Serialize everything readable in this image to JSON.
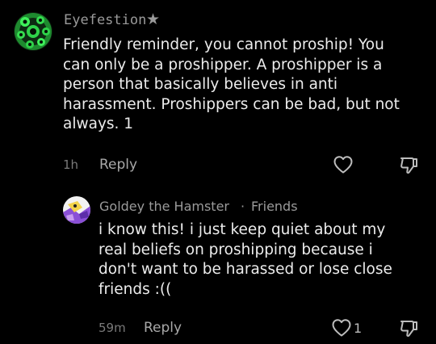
{
  "comment": {
    "username": "Eyefestion",
    "badge_icon": "star-icon",
    "text_lines": [
      "Friendly reminder, you cannot proship! You",
      "can only be a proshipper. A proshipper is a",
      "person that basically believes in anti",
      "harassment. Proshippers can be bad, but not",
      "always. 1"
    ],
    "timestamp": "1h",
    "reply_label": "Reply",
    "like_icon": "heart-icon",
    "dislike_icon": "thumbs-down-icon",
    "avatar_color": "#2fd24a"
  },
  "reply": {
    "username": "Goldey the Hamster",
    "separator": "·",
    "relation": "Friends",
    "text_lines": [
      "i know this! i just keep quiet about my",
      "real beliefs on proshipping because i",
      "don't want to be harassed or lose close",
      "friends :(("
    ],
    "timestamp": "59m",
    "reply_label": "Reply",
    "like_count": "1",
    "like_icon": "heart-icon",
    "dislike_icon": "thumbs-down-icon",
    "avatar_bg": "#f2f2f2",
    "avatar_accent": "#8a4fd6"
  }
}
